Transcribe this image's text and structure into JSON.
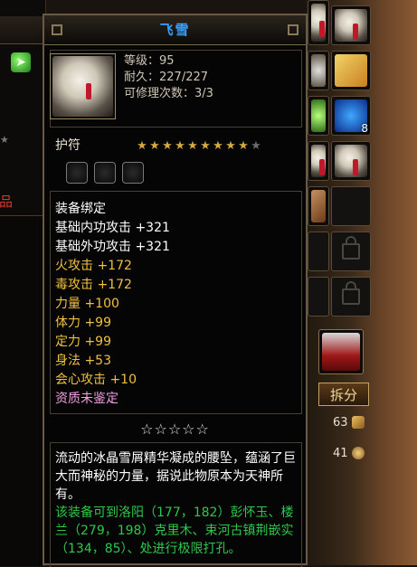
{
  "item": {
    "name": "飞雪",
    "level_line": "等级：95",
    "durability_line": "耐久：227/227",
    "repair_line": "可修理次数：3/3",
    "type": "护符",
    "star_rating": {
      "filled": 9,
      "total": 10
    },
    "gem_sockets": 3,
    "attributes": [
      {
        "text": "装备绑定",
        "color": "#ffffff"
      },
      {
        "text": "基础内功攻击 +321",
        "color": "#ffffff"
      },
      {
        "text": "基础外功攻击 +321",
        "color": "#ffffff"
      },
      {
        "text": "火攻击 +172",
        "color": "#f0c040"
      },
      {
        "text": "毒攻击 +172",
        "color": "#f0c040"
      },
      {
        "text": "力量 +100",
        "color": "#f0c040"
      },
      {
        "text": "体力 +99",
        "color": "#f0c040"
      },
      {
        "text": "定力 +99",
        "color": "#f0c040"
      },
      {
        "text": "身法 +53",
        "color": "#f0c040"
      },
      {
        "text": "会心攻击 +10",
        "color": "#f0c040"
      },
      {
        "text": "资质未鉴定",
        "color": "#f0a0e0"
      }
    ],
    "quality_stars": "☆☆☆☆☆",
    "description": "流动的冰晶雪屑精华凝成的腰坠，蕴涵了巨大而神秘的力量，据说此物原本为天神所有。",
    "inlay_hint": "该装备可到洛阳（177，182）彭怀玉、楼兰（279，198）克里木、束河古镇荆嵌实（134，85）、处进行极限打孔。"
  },
  "inventory": {
    "split_button_label": "拆分",
    "rune_badge": "8",
    "count_gold": "63",
    "count_coin": "41"
  },
  "left_panel": {
    "red_fragment": "珍品"
  },
  "colors": {
    "title_blue": "#3aa0ff",
    "gold_attr": "#f0c040",
    "desc_white": "#ffffff",
    "inlay_green": "#2ec84a"
  }
}
